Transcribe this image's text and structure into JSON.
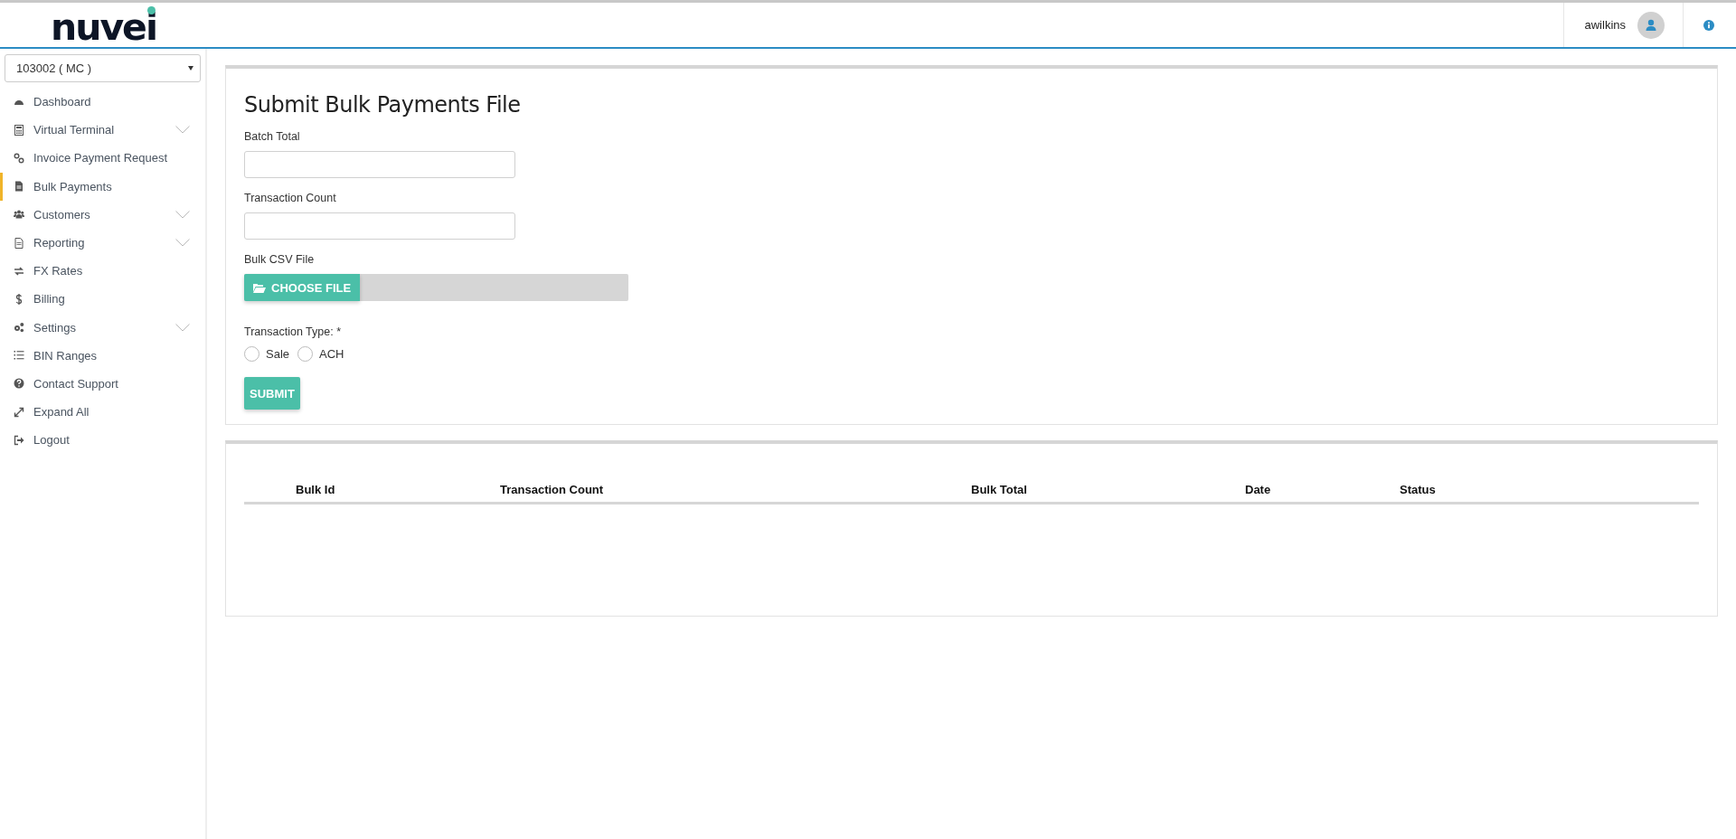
{
  "header": {
    "logo": "nuvei",
    "username": "awilkins"
  },
  "sidebar": {
    "account": "103002 ( MC )",
    "items": [
      {
        "label": "Dashboard",
        "expandable": false,
        "selected": false
      },
      {
        "label": "Virtual Terminal",
        "expandable": true,
        "selected": false
      },
      {
        "label": "Invoice Payment Request",
        "expandable": false,
        "selected": false
      },
      {
        "label": "Bulk Payments",
        "expandable": false,
        "selected": true
      },
      {
        "label": "Customers",
        "expandable": true,
        "selected": false
      },
      {
        "label": "Reporting",
        "expandable": true,
        "selected": false
      },
      {
        "label": "FX Rates",
        "expandable": false,
        "selected": false
      },
      {
        "label": "Billing",
        "expandable": false,
        "selected": false
      },
      {
        "label": "Settings",
        "expandable": true,
        "selected": false
      },
      {
        "label": "BIN Ranges",
        "expandable": false,
        "selected": false
      },
      {
        "label": "Contact Support",
        "expandable": false,
        "selected": false
      },
      {
        "label": "Expand All",
        "expandable": false,
        "selected": false
      },
      {
        "label": "Logout",
        "expandable": false,
        "selected": false
      }
    ]
  },
  "form": {
    "title": "Submit Bulk Payments File",
    "batch_total_label": "Batch Total",
    "transaction_count_label": "Transaction Count",
    "file_label": "Bulk CSV File",
    "choose_file": "CHOOSE FILE",
    "transaction_type_label": "Transaction Type: *",
    "transaction_types": [
      {
        "label": "Sale",
        "selected": false
      },
      {
        "label": "ACH",
        "selected": false
      }
    ],
    "submit": "SUBMIT"
  },
  "table": {
    "columns": [
      "Bulk Id",
      "Transaction Count",
      "Bulk Total",
      "Date",
      "Status"
    ]
  }
}
